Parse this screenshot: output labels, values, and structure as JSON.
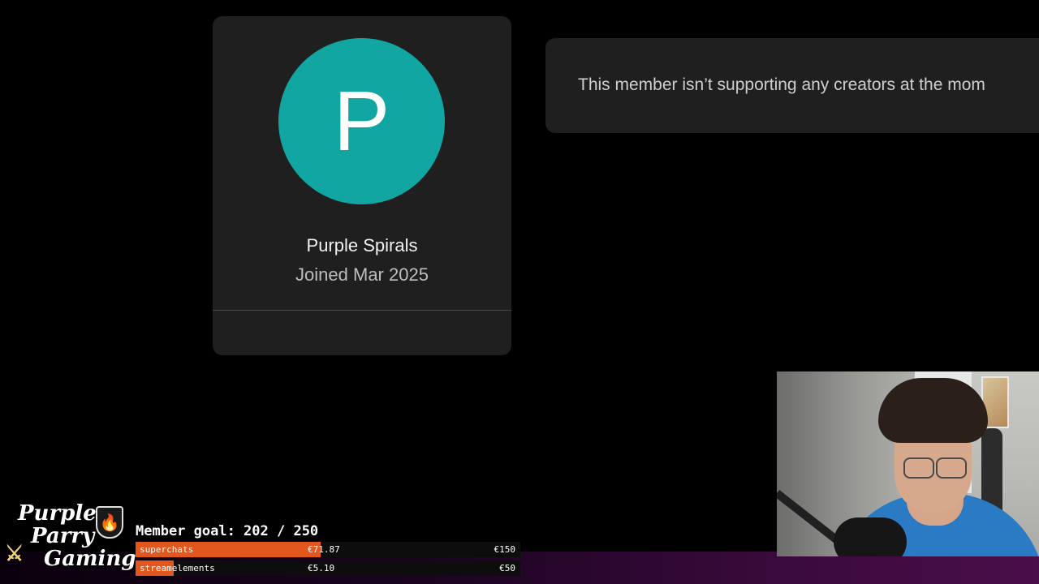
{
  "profile": {
    "avatar_initial": "P",
    "avatar_color": "#12a6a2",
    "name": "Purple Spirals",
    "joined": "Joined Mar 2025"
  },
  "message": {
    "text": "This member isn’t supporting any creators at the mom"
  },
  "overlay": {
    "logo": {
      "line1": "Purple",
      "line2": "Parry",
      "line3": "Gaming",
      "icons": [
        "shield-flame-icon",
        "crossed-swords-icon"
      ]
    },
    "goal_title": "Member goal: 202 / 250",
    "bars": [
      {
        "label": "superchats",
        "current": "€71.87",
        "target": "€150",
        "progress": 0.48,
        "color": "#e2571e"
      },
      {
        "label": "streamelements",
        "current": "€5.10",
        "target": "€50",
        "progress": 0.1,
        "color": "#e2571e"
      }
    ]
  },
  "webcam": {
    "label": "streamer webcam feed"
  }
}
